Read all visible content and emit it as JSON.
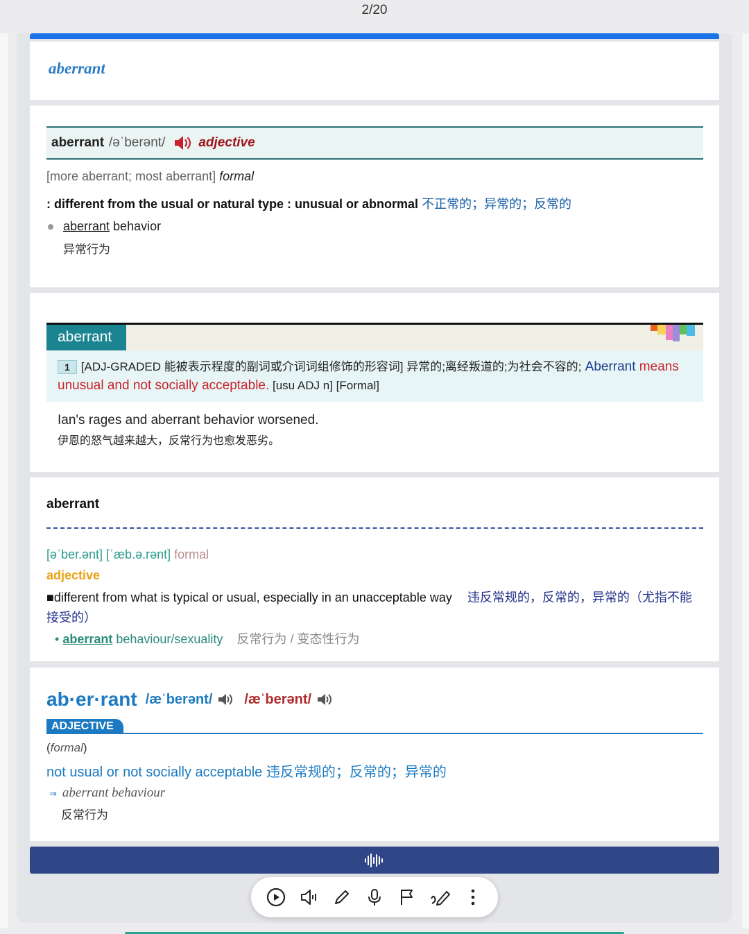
{
  "counter": "2/20",
  "card1": {
    "headword": "aberrant"
  },
  "mw": {
    "word": "aberrant",
    "pron": "/əˈberənt/",
    "pos": "adjective",
    "inflect_open": "[more aberrant; most aberrant]",
    "inflect_label": "formal",
    "def_prefix": ": different from the usual or natural type : unusual or abnormal",
    "def_zh": " 不正常的；异常的；反常的",
    "ex_word": "aberrant",
    "ex_rest": " behavior",
    "ex_zh": "异常行为"
  },
  "collins": {
    "tab": "aberrant",
    "num": "1",
    "gram": "[ADJ-GRADED 能被表示程度的副词或介词词组修饰的形容词] 异常的;离经叛道的;为社会不容的;",
    "en1": " Aberrant",
    "red": " means unusual and not socially acceptable.",
    "tail": " [usu ADJ n] [Formal]",
    "ex": "Ian's rages and aberrant behavior worsened.",
    "ex_zh": "伊恩的怒气越来越大，反常行为也愈发恶劣。"
  },
  "oxford": {
    "word": "aberrant",
    "pron": "[əˈber.ənt] [ˈæb.ə.rənt]",
    "register": "formal",
    "pos": "adjective",
    "def": "■different from what is typical or usual, especially in an unacceptable way",
    "def_zh": "违反常规的，反常的，异常的（尤指不能接受的）",
    "ex_word": "aberrant",
    "ex_rest": " behaviour/sexuality",
    "ex_zh": "反常行为 / 变态性行为"
  },
  "longman": {
    "word": "ab·er·rant",
    "pron_br": "/æˈberənt/",
    "pron_us": "/æˈberənt/",
    "tag": "ADJECTIVE",
    "register": "formal",
    "def": "not usual or not socially acceptable 违反常规的；反常的；异常的",
    "arrow": "⇒",
    "ex": "aberrant behaviour",
    "ex_zh": "反常行为"
  },
  "colors": {
    "accent": "#1a73e8",
    "collins_tab": "#1a8591",
    "play_bar": "#2f4687",
    "mw_pos": "#a0141e"
  },
  "toolbar": [
    "play-icon",
    "speaker-icon",
    "pencil-icon",
    "microphone-icon",
    "flag-icon",
    "handwriting-icon",
    "more-icon"
  ]
}
